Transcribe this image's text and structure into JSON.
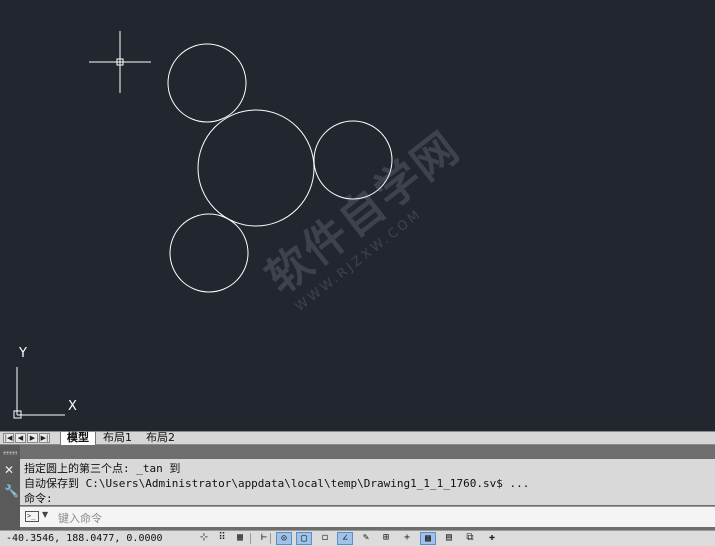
{
  "drawing": {
    "ucs": {
      "x_label": "X",
      "y_label": "Y"
    },
    "watermark": {
      "main": "软件自学网",
      "sub": "WWW.RJZXW.COM"
    }
  },
  "layout_tabs": {
    "nav_buttons": [
      "first-icon",
      "prev-icon",
      "next-icon",
      "last-icon"
    ],
    "tabs": [
      {
        "label": "模型",
        "active": true
      },
      {
        "label": "布局1",
        "active": false
      },
      {
        "label": "布局2",
        "active": false
      }
    ]
  },
  "command": {
    "history": [
      "指定圆上的第三个点: _tan 到",
      "自动保存到 C:\\Users\\Administrator\\appdata\\local\\temp\\Drawing1_1_1_1760.sv$ ...",
      "命令:"
    ],
    "input_placeholder": "键入命令",
    "input_value": "",
    "close_icon": "close-icon",
    "customize_icon": "wrench-icon"
  },
  "status": {
    "coordinates": "-40.3546, 188.0477, 0.0000",
    "buttons": [
      {
        "name": "infer-constraints-icon",
        "glyph": "⊹",
        "on": false
      },
      {
        "name": "snap-mode-icon",
        "glyph": "⠿",
        "on": false
      },
      {
        "name": "grid-display-icon",
        "glyph": "▦",
        "on": false
      },
      {
        "name": "ortho-mode-icon",
        "glyph": "⊢",
        "on": false
      },
      {
        "name": "polar-tracking-icon",
        "glyph": "⊙",
        "on": true
      },
      {
        "name": "object-snap-icon",
        "glyph": "▢",
        "on": true
      },
      {
        "name": "3d-object-snap-icon",
        "glyph": "◻",
        "on": false
      },
      {
        "name": "object-snap-tracking-icon",
        "glyph": "∠",
        "on": true
      },
      {
        "name": "dynamic-ucs-icon",
        "glyph": "✎",
        "on": false
      },
      {
        "name": "dynamic-input-icon",
        "glyph": "⊞",
        "on": false
      },
      {
        "name": "lineweight-icon",
        "glyph": "+",
        "on": false
      },
      {
        "name": "transparency-icon",
        "glyph": "▩",
        "on": true
      },
      {
        "name": "quick-properties-icon",
        "glyph": "▤",
        "on": false
      },
      {
        "name": "selection-cycling-icon",
        "glyph": "⧉",
        "on": false
      },
      {
        "name": "annotation-monitor-icon",
        "glyph": "✚",
        "on": false
      }
    ]
  },
  "colors": {
    "canvas_bg": "#22262e",
    "geometry": "#ffffff",
    "status_on": "#9fc3e8"
  }
}
